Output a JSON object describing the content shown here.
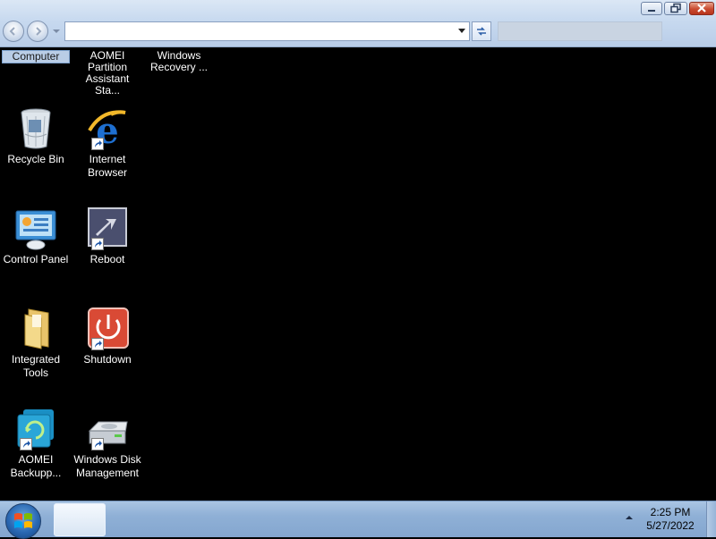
{
  "explorer": {
    "address_value": "",
    "window_controls": [
      "minimize",
      "maximize",
      "close"
    ]
  },
  "desktop": {
    "top_row": [
      {
        "label": "Computer",
        "selected": true
      },
      {
        "label_line1": "AOMEI Partition",
        "label_line2": "Assistant Sta..."
      },
      {
        "label_line1": "Windows",
        "label_line2": "Recovery ..."
      }
    ],
    "icons": [
      {
        "label_line1": "Recycle Bin",
        "label_line2": "",
        "icon": "recycle-bin-icon"
      },
      {
        "label_line1": "Internet",
        "label_line2": "Browser",
        "icon": "internet-explorer-icon"
      },
      {
        "label_line1": "Control Panel",
        "label_line2": "",
        "icon": "control-panel-icon"
      },
      {
        "label_line1": "Reboot",
        "label_line2": "",
        "icon": "reboot-icon"
      },
      {
        "label_line1": "Integrated",
        "label_line2": "Tools",
        "icon": "folder-icon"
      },
      {
        "label_line1": "Shutdown",
        "label_line2": "",
        "icon": "shutdown-icon"
      },
      {
        "label_line1": "AOMEI",
        "label_line2": "Backupp...",
        "icon": "aomei-backupper-icon"
      },
      {
        "label_line1": "Windows Disk",
        "label_line2": "Management",
        "icon": "disk-management-icon"
      }
    ]
  },
  "taskbar": {
    "time": "2:25 PM",
    "date": "5/27/2022",
    "start_icon": "windows-logo-icon"
  },
  "colors": {
    "desktop_bg": "#000000",
    "taskbar": "#8fb0d6",
    "chrome": "#c7d9ef"
  }
}
